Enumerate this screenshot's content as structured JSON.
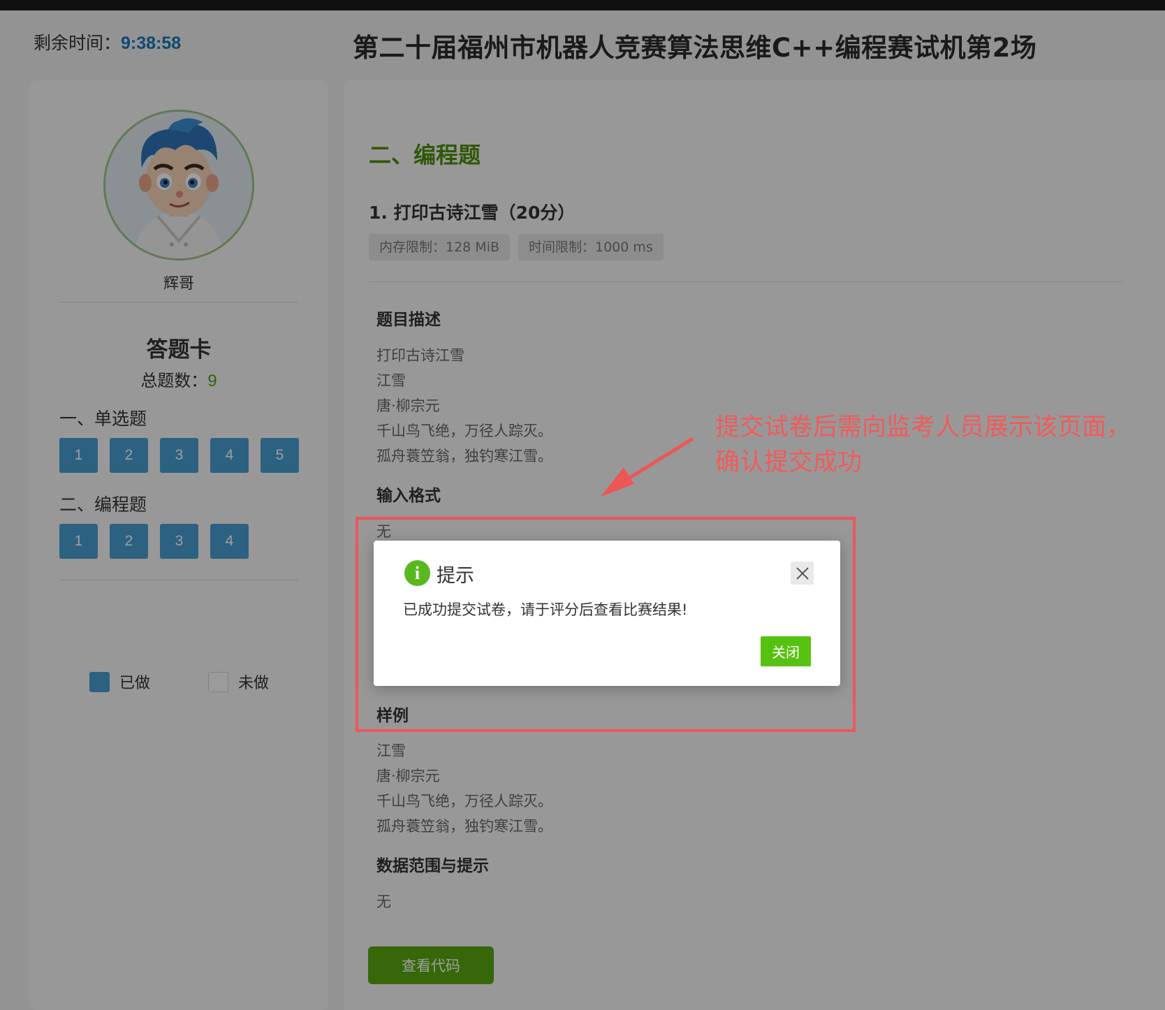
{
  "header": {
    "timer_label": "剩余时间：",
    "timer_value": "9:38:58",
    "exam_title": "第二十届福州市机器人竞赛算法思维C++编程赛试机第2场"
  },
  "sidebar": {
    "user_name": "辉哥",
    "card_title": "答题卡",
    "total_label": "总题数：",
    "total_count": "9",
    "section1_label": "一、单选题",
    "section1_buttons": [
      "1",
      "2",
      "3",
      "4",
      "5"
    ],
    "section2_label": "二、编程题",
    "section2_buttons": [
      "1",
      "2",
      "3",
      "4"
    ],
    "legend_done": "已做",
    "legend_todo": "未做",
    "colors": {
      "answered": "#4a9dd0"
    }
  },
  "main": {
    "section_title": "二、编程题",
    "problem_title": "1. 打印古诗江雪（20分）",
    "memory_limit": "内存限制：128 MiB",
    "time_limit": "时间限制：1000 ms",
    "desc_heading": "题目描述",
    "desc_lines": [
      "打印古诗江雪",
      "江雪",
      "唐·柳宗元",
      "千山鸟飞绝，万径人踪灭。",
      "孤舟蓑笠翁，独钓寒江雪。"
    ],
    "input_heading": "输入格式",
    "input_text": "无",
    "sample_heading": "样例",
    "sample_lines": [
      "江雪",
      "唐·柳宗元",
      "千山鸟飞绝，万径人踪灭。",
      "孤舟蓑笠翁，独钓寒江雪。"
    ],
    "range_heading": "数据范围与提示",
    "range_text": "无",
    "view_code_label": "查看代码"
  },
  "dialog": {
    "icon_glyph": "i",
    "title": "提示",
    "message": "已成功提交试卷，请于评分后查看比赛结果!",
    "close_label": "关闭"
  },
  "annotation": {
    "line1": "提交试卷后需向监考人员展示该页面，",
    "line2": "确认提交成功",
    "color": "#ee5656"
  }
}
